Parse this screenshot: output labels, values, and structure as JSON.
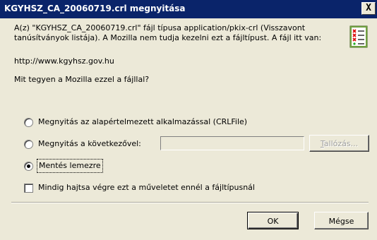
{
  "window": {
    "title": "KGYHSZ_CA_20060719.crl megnyitása",
    "close_label": "X"
  },
  "message": {
    "text": "A(z) \"KGYHSZ_CA_20060719.crl\" fájl típusa application/pkix-crl (Visszavont tanúsítványok listája). A Mozilla nem tudja kezelni ezt a fájltípust. A fájl itt van:",
    "url": "http://www.kgyhsz.gov.hu",
    "question": "Mit tegyen a Mozilla ezzel a fájllal?"
  },
  "options": {
    "open_default": "Megnyitás az alapértelmezett alkalmazással (CRLFile)",
    "open_with": "Megnyitás a következővel:",
    "save": "Mentés lemezre",
    "selected": "save"
  },
  "app_field": {
    "value": ""
  },
  "browse_button": {
    "label_underlined": "T",
    "label_rest": "allózás..."
  },
  "always_checkbox": {
    "label": "Mindig hajtsa végre ezt a műveletet ennél a fájltípusnál",
    "checked": false
  },
  "buttons": {
    "ok": "OK",
    "cancel": "Mégse"
  },
  "colors": {
    "titlebar": "#0a246a",
    "dialog_bg": "#ece9d8"
  },
  "icons": {
    "file_type": "certificate-list-icon",
    "close": "close-icon"
  }
}
